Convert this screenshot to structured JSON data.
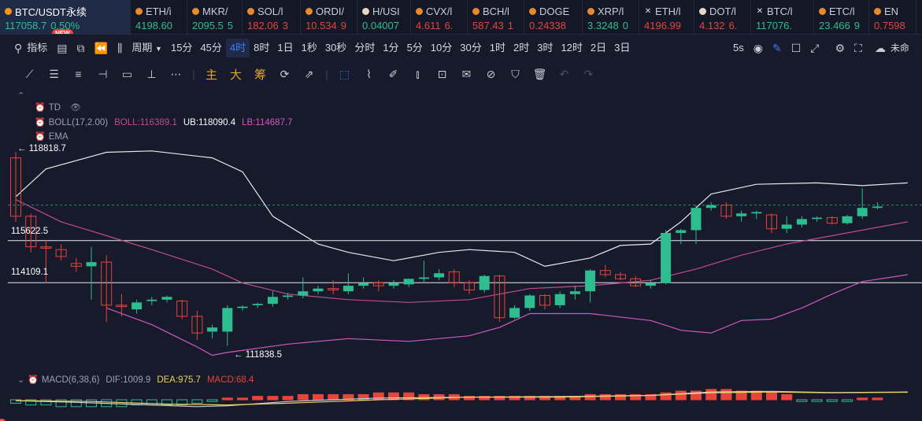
{
  "tickers": [
    {
      "symbol": "BTC/USDT永续",
      "price": "117058.7",
      "change": "0.50%",
      "direction": "up",
      "dot": "#f7931a",
      "active": true,
      "badge": "NEW",
      "width": 166
    },
    {
      "symbol": "ETH/ὶ",
      "price": "4198.60",
      "direction": "up",
      "dot": "#e8892e",
      "width": 72
    },
    {
      "symbol": "MKR/",
      "price": "2095.5",
      "change": "5",
      "direction": "up",
      "dot": "#e8892e",
      "width": 70
    },
    {
      "symbol": "SOL/l",
      "price": "182.06",
      "change": "3",
      "direction": "down",
      "dot": "#e8892e",
      "width": 74
    },
    {
      "symbol": "ORDI/",
      "price": "10.534",
      "change": "9",
      "direction": "down",
      "dot": "#e8892e",
      "width": 72
    },
    {
      "symbol": "H/USI",
      "price": "0.04007",
      "direction": "up",
      "dot": "#e6d9c2",
      "width": 68
    },
    {
      "symbol": "CVX/l",
      "price": "4.611",
      "change": "6.",
      "direction": "down",
      "dot": "#e8892e",
      "width": 72
    },
    {
      "symbol": "BCH/l",
      "price": "587.43",
      "change": "1",
      "direction": "down",
      "dot": "#e8892e",
      "width": 72
    },
    {
      "symbol": "DOGE",
      "price": "0.24338",
      "direction": "down",
      "dot": "#e8892e",
      "width": 74
    },
    {
      "symbol": "XRP/l",
      "price": "3.3248",
      "change": "0",
      "direction": "up",
      "dot": "#e8892e",
      "width": 72
    },
    {
      "symbol": "ETH/l",
      "price": "4196.99",
      "direction": "down",
      "dot": "x",
      "width": 70
    },
    {
      "symbol": "DOT/l",
      "price": "4.132",
      "change": "6.",
      "direction": "down",
      "dot": "#e6d9c2",
      "width": 72
    },
    {
      "symbol": "BTC/l",
      "price": "117076.",
      "direction": "up",
      "dot": "x",
      "width": 80
    },
    {
      "symbol": "ETC/l",
      "price": "23.466",
      "change": "9",
      "direction": "up",
      "dot": "#e8892e",
      "width": 70
    },
    {
      "symbol": "EN",
      "price": "0.7598",
      "direction": "down",
      "dot": "#e8892e",
      "width": 60
    }
  ],
  "toolbar": {
    "indicators_label": "指标",
    "period_label": "周期",
    "intervals": [
      "15分",
      "45分",
      "4时",
      "8时",
      "1日",
      "1秒",
      "30秒",
      "分时",
      "1分",
      "5分",
      "10分",
      "30分",
      "1时",
      "2时",
      "3时",
      "12时",
      "2日",
      "3日"
    ],
    "selected_interval": "4时",
    "refresh_label": "5s",
    "right_label": "未命"
  },
  "draw_tools": {
    "main_label": "主",
    "big_label": "大",
    "chip_label": "筹"
  },
  "legends": {
    "td": {
      "name": "TD"
    },
    "boll": {
      "name": "BOLL(17,2.00)",
      "boll": "BOLL:116389.1",
      "ub": "UB:118090.4",
      "lb": "LB:114687.7"
    },
    "ema": {
      "name": "EMA"
    },
    "macd": {
      "name": "MACD(6,38,6)",
      "dif": "DIF:1009.9",
      "dea": "DEA:975.7",
      "macd": "MACD:68.4"
    }
  },
  "price_labels": {
    "high": "118818.7",
    "low": "111838.5",
    "level1": "115622.5",
    "level2": "114109.1"
  },
  "colors": {
    "up": "#2ebd8f",
    "down": "#e5453a",
    "accent": "#3d7df6",
    "background": "#161a2b"
  },
  "chart_data": {
    "type": "candlestick",
    "candles": [
      {
        "o": 118600,
        "h": 118818.7,
        "l": 116300,
        "c": 116500
      },
      {
        "o": 116500,
        "h": 116600,
        "l": 115200,
        "c": 115400
      },
      {
        "o": 115400,
        "h": 115650,
        "l": 114100,
        "c": 115350
      },
      {
        "o": 115300,
        "h": 115500,
        "l": 114900,
        "c": 115050
      },
      {
        "o": 114800,
        "h": 115000,
        "l": 114500,
        "c": 114700
      },
      {
        "o": 114700,
        "h": 115400,
        "l": 113500,
        "c": 114850
      },
      {
        "o": 114850,
        "h": 115100,
        "l": 112700,
        "c": 113300
      },
      {
        "o": 113300,
        "h": 113700,
        "l": 112900,
        "c": 113250
      },
      {
        "o": 113150,
        "h": 113500,
        "l": 113000,
        "c": 113400
      },
      {
        "o": 113450,
        "h": 113600,
        "l": 113300,
        "c": 113500
      },
      {
        "o": 113500,
        "h": 113650,
        "l": 113400,
        "c": 113600
      },
      {
        "o": 113450,
        "h": 113500,
        "l": 112800,
        "c": 112900
      },
      {
        "o": 112900,
        "h": 113100,
        "l": 112050,
        "c": 112300
      },
      {
        "o": 112350,
        "h": 112600,
        "l": 112100,
        "c": 112500
      },
      {
        "o": 112350,
        "h": 113300,
        "l": 111838.5,
        "c": 113200
      },
      {
        "o": 113200,
        "h": 113300,
        "l": 113100,
        "c": 113250
      },
      {
        "o": 113300,
        "h": 113400,
        "l": 113200,
        "c": 113350
      },
      {
        "o": 113350,
        "h": 113800,
        "l": 113250,
        "c": 113600
      },
      {
        "o": 113600,
        "h": 113750,
        "l": 113500,
        "c": 113650
      },
      {
        "o": 113650,
        "h": 114300,
        "l": 113550,
        "c": 113800
      },
      {
        "o": 113800,
        "h": 114000,
        "l": 113700,
        "c": 113900
      },
      {
        "o": 113900,
        "h": 114200,
        "l": 113700,
        "c": 113850
      },
      {
        "o": 113800,
        "h": 114450,
        "l": 113700,
        "c": 114000
      },
      {
        "o": 114000,
        "h": 114300,
        "l": 113900,
        "c": 114100
      },
      {
        "o": 114100,
        "h": 114200,
        "l": 113800,
        "c": 114000
      },
      {
        "o": 114000,
        "h": 114200,
        "l": 113900,
        "c": 114100
      },
      {
        "o": 114050,
        "h": 114250,
        "l": 113950,
        "c": 114250
      },
      {
        "o": 114250,
        "h": 114900,
        "l": 114100,
        "c": 114300
      },
      {
        "o": 114300,
        "h": 114600,
        "l": 114200,
        "c": 114450
      },
      {
        "o": 114500,
        "h": 114600,
        "l": 113950,
        "c": 114100
      },
      {
        "o": 114100,
        "h": 114200,
        "l": 113700,
        "c": 113850
      },
      {
        "o": 113850,
        "h": 114400,
        "l": 113750,
        "c": 114350
      },
      {
        "o": 114350,
        "h": 114400,
        "l": 112700,
        "c": 112850
      },
      {
        "o": 112850,
        "h": 113300,
        "l": 112800,
        "c": 113200
      },
      {
        "o": 113200,
        "h": 113700,
        "l": 113100,
        "c": 113650
      },
      {
        "o": 113650,
        "h": 113700,
        "l": 113150,
        "c": 113300
      },
      {
        "o": 113300,
        "h": 113800,
        "l": 113200,
        "c": 113700
      },
      {
        "o": 113700,
        "h": 114000,
        "l": 113500,
        "c": 113800
      },
      {
        "o": 113800,
        "h": 114600,
        "l": 113400,
        "c": 114550
      },
      {
        "o": 114550,
        "h": 114750,
        "l": 114300,
        "c": 114400
      },
      {
        "o": 114400,
        "h": 114500,
        "l": 114200,
        "c": 114250
      },
      {
        "o": 114250,
        "h": 114350,
        "l": 113950,
        "c": 114000
      },
      {
        "o": 114000,
        "h": 114200,
        "l": 113900,
        "c": 114100
      },
      {
        "o": 114100,
        "h": 116000,
        "l": 114050,
        "c": 115900
      },
      {
        "o": 115900,
        "h": 116050,
        "l": 115500,
        "c": 116000
      },
      {
        "o": 116000,
        "h": 116900,
        "l": 115500,
        "c": 116800
      },
      {
        "o": 116800,
        "h": 117000,
        "l": 116700,
        "c": 116900
      },
      {
        "o": 116900,
        "h": 117000,
        "l": 116400,
        "c": 116500
      },
      {
        "o": 116500,
        "h": 116700,
        "l": 116300,
        "c": 116600
      },
      {
        "o": 116600,
        "h": 116700,
        "l": 116400,
        "c": 116650
      },
      {
        "o": 116550,
        "h": 116600,
        "l": 115900,
        "c": 116050
      },
      {
        "o": 116050,
        "h": 116500,
        "l": 115900,
        "c": 116200
      },
      {
        "o": 116200,
        "h": 116500,
        "l": 116100,
        "c": 116400
      },
      {
        "o": 116400,
        "h": 116500,
        "l": 116300,
        "c": 116450
      },
      {
        "o": 116450,
        "h": 116500,
        "l": 116200,
        "c": 116250
      },
      {
        "o": 116250,
        "h": 116550,
        "l": 116200,
        "c": 116500
      },
      {
        "o": 116500,
        "h": 117500,
        "l": 116400,
        "c": 116800
      },
      {
        "o": 116800,
        "h": 117000,
        "l": 116750,
        "c": 116850
      }
    ],
    "boll_ub": [
      [
        0,
        117200
      ],
      [
        2,
        118200
      ],
      [
        6,
        118800
      ],
      [
        9,
        118850
      ],
      [
        13,
        118600
      ],
      [
        15,
        118100
      ],
      [
        17,
        116500
      ],
      [
        20,
        115500
      ],
      [
        22,
        115200
      ],
      [
        25,
        114900
      ],
      [
        28,
        115200
      ],
      [
        30,
        115300
      ],
      [
        33,
        115200
      ],
      [
        35,
        114700
      ],
      [
        38,
        115000
      ],
      [
        40,
        115450
      ],
      [
        42,
        115500
      ],
      [
        44,
        116300
      ],
      [
        46,
        117300
      ],
      [
        49,
        117650
      ],
      [
        53,
        117700
      ],
      [
        56,
        117600
      ],
      [
        59,
        117700
      ]
    ],
    "boll_mid": [
      [
        0,
        117100
      ],
      [
        3,
        116300
      ],
      [
        6,
        115800
      ],
      [
        9,
        115300
      ],
      [
        13,
        114600
      ],
      [
        15,
        114100
      ],
      [
        18,
        113700
      ],
      [
        22,
        113500
      ],
      [
        26,
        113400
      ],
      [
        30,
        113500
      ],
      [
        32,
        113700
      ],
      [
        34,
        113900
      ],
      [
        36,
        113950
      ],
      [
        38,
        114000
      ],
      [
        40,
        114100
      ],
      [
        42,
        114200
      ],
      [
        45,
        114600
      ],
      [
        48,
        115100
      ],
      [
        51,
        115500
      ],
      [
        54,
        115800
      ],
      [
        57,
        116100
      ],
      [
        59,
        116300
      ]
    ],
    "boll_lb": [
      [
        6,
        113200
      ],
      [
        9,
        112600
      ],
      [
        12,
        111800
      ],
      [
        13,
        111500
      ],
      [
        14,
        111600
      ],
      [
        18,
        111900
      ],
      [
        22,
        112100
      ],
      [
        26,
        112000
      ],
      [
        30,
        112200
      ],
      [
        32,
        112500
      ],
      [
        34,
        113000
      ],
      [
        38,
        113000
      ],
      [
        42,
        112750
      ],
      [
        44,
        112400
      ],
      [
        46,
        112300
      ],
      [
        48,
        112750
      ],
      [
        50,
        112800
      ],
      [
        52,
        113200
      ],
      [
        54,
        113700
      ],
      [
        56,
        114150
      ],
      [
        59,
        114400
      ]
    ],
    "macd_hist": [
      -2,
      -3,
      -3,
      -4,
      -4,
      -4,
      -4,
      -4,
      -3,
      -3,
      -3,
      -3,
      -2,
      -1,
      1,
      1,
      2,
      2,
      2,
      3,
      3,
      3,
      3,
      3,
      4,
      4,
      4,
      3,
      3,
      3,
      2,
      2,
      2,
      2,
      2,
      2,
      2,
      2,
      3,
      3,
      3,
      3,
      3,
      4,
      5,
      5,
      6,
      6,
      5,
      5,
      4,
      3,
      -1,
      -1,
      -1,
      -1,
      1,
      1
    ],
    "dif": [
      [
        0,
        -0.5
      ],
      [
        4,
        -1.5
      ],
      [
        9,
        -3
      ],
      [
        12,
        -4
      ],
      [
        14,
        -3.5
      ],
      [
        18,
        -1
      ],
      [
        24,
        1
      ],
      [
        30,
        1.5
      ],
      [
        36,
        1.5
      ],
      [
        42,
        2.5
      ],
      [
        46,
        4.5
      ],
      [
        50,
        4.8
      ],
      [
        54,
        4.2
      ],
      [
        59,
        4.5
      ]
    ],
    "dea": [
      [
        0,
        -0.5
      ],
      [
        5,
        -1
      ],
      [
        10,
        -2.5
      ],
      [
        14,
        -3
      ],
      [
        18,
        -2
      ],
      [
        24,
        0
      ],
      [
        30,
        1.5
      ],
      [
        36,
        1.8
      ],
      [
        42,
        2.5
      ],
      [
        46,
        4
      ],
      [
        50,
        4.5
      ],
      [
        54,
        4
      ],
      [
        59,
        4.3
      ]
    ],
    "current_price": 116900,
    "level_lines": [
      115622.5,
      114109.1
    ]
  }
}
